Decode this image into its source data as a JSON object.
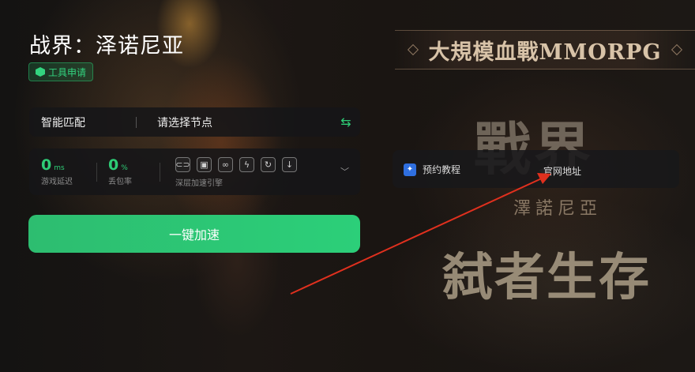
{
  "background": {
    "banner_text": "大規模血戰MMORPG",
    "logo_text": "戰界",
    "logo_sub": "澤諾尼亞",
    "slogan": "弑者生存"
  },
  "header": {
    "title": "战界：泽诺尼亚",
    "tag_label": "工具申请"
  },
  "node_bar": {
    "mode_label": "智能匹配",
    "node_placeholder": "请选择节点",
    "swap_icon": "⇆"
  },
  "stats": {
    "latency_value": "0",
    "latency_unit": "ms",
    "latency_label": "游戏延迟",
    "loss_value": "0",
    "loss_unit": "%",
    "loss_label": "丢包率",
    "engine_label": "深层加速引擎",
    "engine_icons": [
      "link-icon",
      "shield-icon",
      "chain-icon",
      "lightning-icon",
      "refresh-icon",
      "download-icon"
    ]
  },
  "actions": {
    "speed_label": "一键加速"
  },
  "links": {
    "tutorial_label": "预约教程",
    "website_label": "官网地址"
  },
  "colors": {
    "accent": "#2ecc76",
    "annotation_arrow": "#e0301e"
  }
}
